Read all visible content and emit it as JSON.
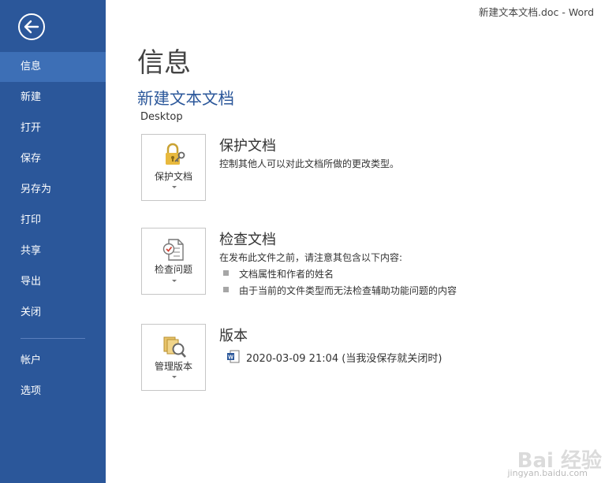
{
  "window": {
    "title": "新建文本文档.doc - Word"
  },
  "sidebar": {
    "items": [
      {
        "label": "信息"
      },
      {
        "label": "新建"
      },
      {
        "label": "打开"
      },
      {
        "label": "保存"
      },
      {
        "label": "另存为"
      },
      {
        "label": "打印"
      },
      {
        "label": "共享"
      },
      {
        "label": "导出"
      },
      {
        "label": "关闭"
      },
      {
        "label": "帐户"
      },
      {
        "label": "选项"
      }
    ],
    "active_index": 0
  },
  "main": {
    "page_title": "信息",
    "doc_title": "新建文本文档",
    "doc_location": "Desktop",
    "protect": {
      "button_label": "保护文档",
      "heading": "保护文档",
      "description": "控制其他人可以对此文档所做的更改类型。"
    },
    "inspect": {
      "button_label": "检查问题",
      "heading": "检查文档",
      "description": "在发布此文件之前，请注意其包含以下内容:",
      "items": [
        "文档属性和作者的姓名",
        "由于当前的文件类型而无法检查辅助功能问题的内容"
      ]
    },
    "versions": {
      "button_label": "管理版本",
      "heading": "版本",
      "entry": "2020-03-09 21:04 (当我没保存就关闭时)"
    }
  },
  "watermark": {
    "text": "Bai 经验",
    "sub": "jingyan.baidu.com"
  },
  "colors": {
    "sidebar_bg": "#2b579a",
    "sidebar_active": "#3d6fb6",
    "accent": "#2b579a"
  }
}
